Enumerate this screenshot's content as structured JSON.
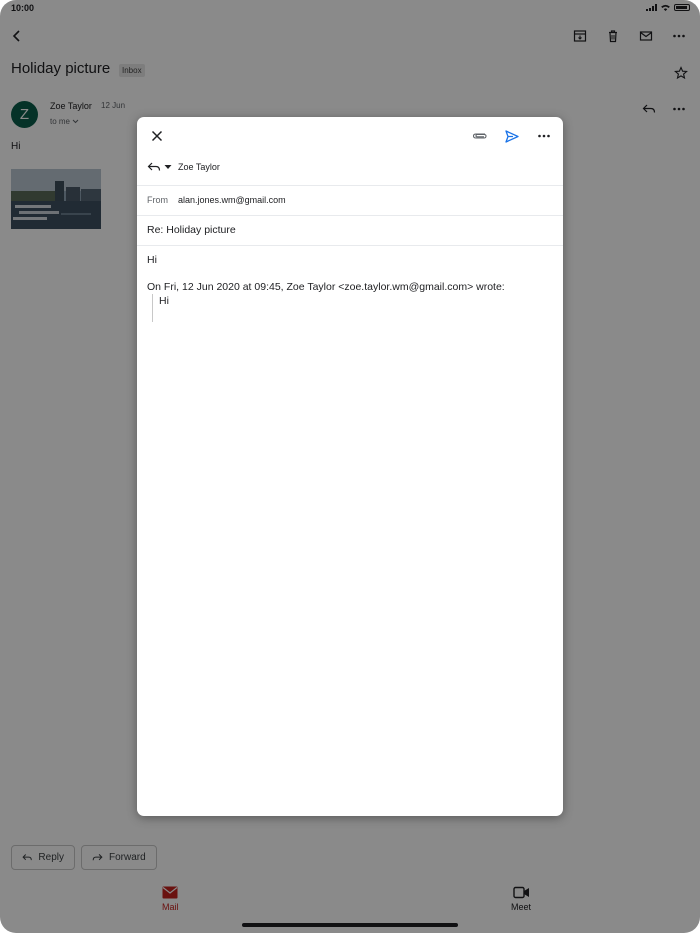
{
  "status_bar": {
    "time": "10:00"
  },
  "email": {
    "subject": "Holiday picture",
    "label": "Inbox",
    "sender_initial": "Z",
    "sender_name": "Zoe Taylor",
    "date": "12 Jun",
    "recipient": "to me",
    "body": "Hi"
  },
  "actions": {
    "reply_label": "Reply",
    "forward_label": "Forward"
  },
  "bottom_nav": {
    "mail_label": "Mail",
    "meet_label": "Meet"
  },
  "compose": {
    "to": "Zoe Taylor",
    "from_label": "From",
    "from_value": "alan.jones.wm@gmail.com",
    "subject": "Re: Holiday picture",
    "body": "Hi",
    "quote_header": "On Fri, 12 Jun 2020 at 09:45, Zoe Taylor <zoe.taylor.wm@gmail.com> wrote:",
    "quote_body": "Hi"
  },
  "colors": {
    "accent_red": "#c5221f",
    "send_blue": "#1a73e8",
    "avatar_green": "#0b5d4a"
  }
}
